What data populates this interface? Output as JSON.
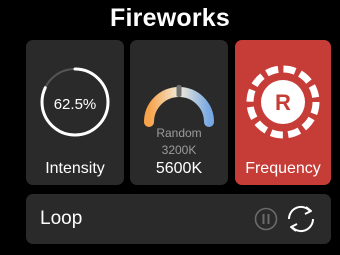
{
  "header": {
    "title": "Fireworks"
  },
  "cards": {
    "intensity": {
      "label": "Intensity",
      "value_text": "62.5%",
      "level": 0.82
    },
    "cct": {
      "mode_text": "Random",
      "range_text": "3200K",
      "value_text": "5600K"
    },
    "frequency": {
      "label": "Frequency",
      "badge": "R"
    }
  },
  "loop": {
    "label": "Loop",
    "pause_icon": "pause-icon",
    "cycle_icon": "loop-cycle-icon"
  },
  "colors": {
    "background": "#000000",
    "card": "#2a2a2a",
    "accent_red": "#c63d38",
    "warm": "#f6a34a",
    "cool": "#78a9e4"
  }
}
